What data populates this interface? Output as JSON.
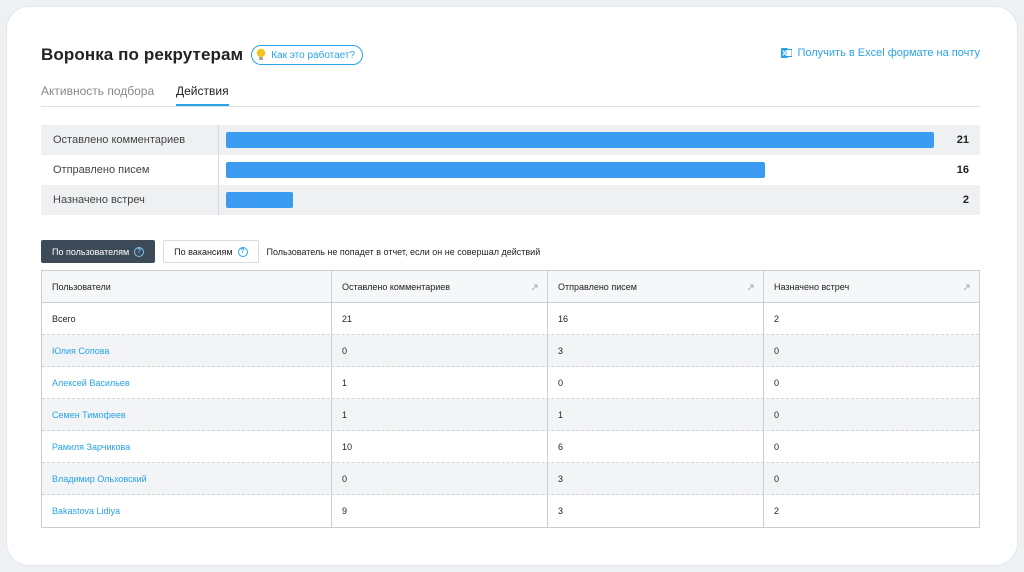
{
  "page": {
    "title": "Воронка по рекрутерам",
    "how_label": "Как это работает?",
    "excel_label": "Получить в Excel формате на почту"
  },
  "tabs": [
    {
      "label": "Активность подбора",
      "active": false
    },
    {
      "label": "Действия",
      "active": true
    }
  ],
  "summary": {
    "max": 21,
    "rows": [
      {
        "label": "Оставлено комментариев",
        "value": "21",
        "num": 21
      },
      {
        "label": "Отправлено писем",
        "value": "16",
        "num": 16
      },
      {
        "label": "Назначено встреч",
        "value": "2",
        "num": 2
      }
    ]
  },
  "toggles": {
    "by_users": "По пользователям",
    "by_vacancies": "По вакансиям",
    "note": "Пользователь не попадет в отчет, если он не совершал действий"
  },
  "table": {
    "columns": [
      "Пользователи",
      "Оставлено комментариев",
      "Отправлено писем",
      "Назначено встреч"
    ],
    "rows": [
      [
        "Всего",
        "21",
        "16",
        "2"
      ],
      [
        "Юлия Сопова",
        "0",
        "3",
        "0"
      ],
      [
        "Алексей Васильев",
        "1",
        "0",
        "0"
      ],
      [
        "Семен Тимофеев",
        "1",
        "1",
        "0"
      ],
      [
        "Рамиля Зарчикова",
        "10",
        "6",
        "0"
      ],
      [
        "Владимир Ольховский",
        "0",
        "3",
        "0"
      ],
      [
        "Bakastova Lidiya",
        "9",
        "3",
        "2"
      ]
    ]
  },
  "colors": {
    "accent": "#29a3e8",
    "bar": "#3b9bf0",
    "toggle_active": "#3d4a58"
  }
}
